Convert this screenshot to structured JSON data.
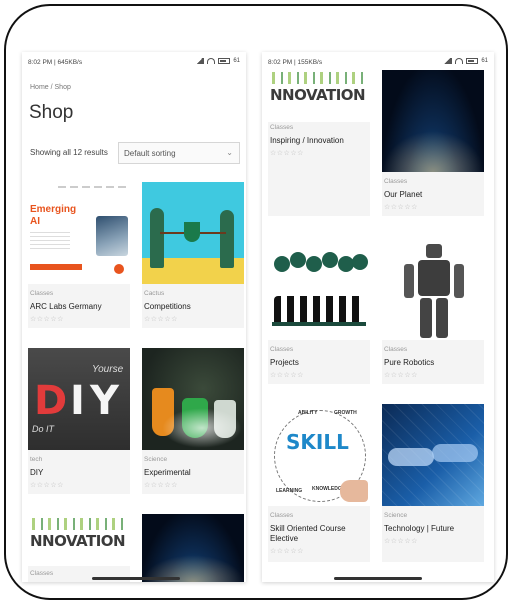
{
  "left_screen": {
    "status": {
      "time": "8:02 PM | 645KB/s",
      "battery": "61"
    },
    "breadcrumb": "Home / Shop",
    "title": "Shop",
    "result_count": "Showing all 12 results",
    "sort": {
      "selected": "Default sorting"
    },
    "products": [
      {
        "category": "Classes",
        "name": "ARC Labs Germany",
        "rating": "☆☆☆☆☆",
        "thumb": {
          "headline": "Emerging\nAI"
        }
      },
      {
        "category": "Cactus",
        "name": "Competitions",
        "rating": "☆☆☆☆☆"
      },
      {
        "category": "tech",
        "name": "DIY",
        "rating": "☆☆☆☆☆",
        "thumb": {
          "letters": [
            "D",
            "I",
            "Y"
          ],
          "scribble_top": "Yourse",
          "scribble_bottom": "Do   IT"
        }
      },
      {
        "category": "Science",
        "name": "Experimental",
        "rating": "☆☆☆☆☆"
      },
      {
        "category": "Classes",
        "name": "",
        "rating": "",
        "thumb": {
          "word": "NNOVATION"
        }
      },
      {
        "category": "",
        "name": "",
        "rating": ""
      }
    ]
  },
  "right_screen": {
    "status": {
      "time": "8:02 PM | 155KB/s",
      "battery": "61"
    },
    "products": [
      {
        "category": "Classes",
        "name": "Inspiring / Innovation",
        "rating": "☆☆☆☆☆",
        "thumb": {
          "word": "NNOVATION"
        }
      },
      {
        "category": "Classes",
        "name": "Our Planet",
        "rating": "☆☆☆☆☆"
      },
      {
        "category": "Classes",
        "name": "Projects",
        "rating": "☆☆☆☆☆"
      },
      {
        "category": "Classes",
        "name": "Pure Robotics",
        "rating": "☆☆☆☆☆"
      },
      {
        "category": "Classes",
        "name": "Skill Oriented Course Elective",
        "rating": "☆☆☆☆☆",
        "thumb": {
          "word": "SKILL",
          "labels": [
            "ABILITY",
            "GROWTH",
            "LEARNING",
            "KNOWLEDGE"
          ]
        }
      },
      {
        "category": "Science",
        "name": "Technology | Future",
        "rating": "☆☆☆☆☆"
      }
    ]
  },
  "colors": {
    "accent": "#e8541e",
    "rating": "#bbbbbb",
    "card_bg": "#f4f4f4"
  }
}
